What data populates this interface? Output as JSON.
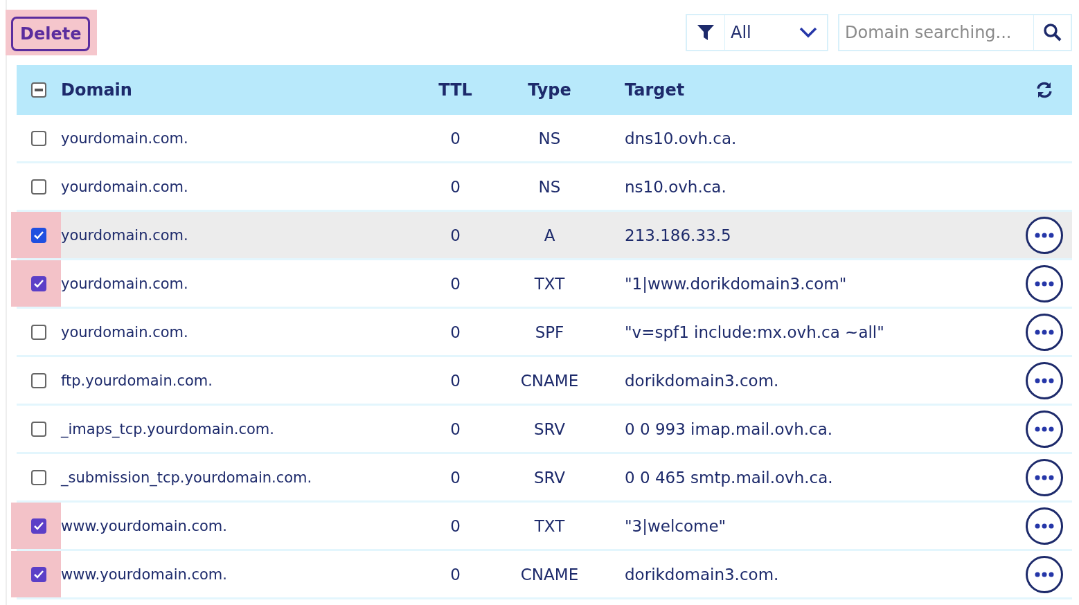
{
  "toolbar": {
    "delete_button": {
      "label": "Delete",
      "highlighted": true
    },
    "filter": {
      "value": "All"
    },
    "search": {
      "placeholder": "Domain searching..."
    }
  },
  "table": {
    "select_all_partial": true,
    "columns": [
      "Domain",
      "TTL",
      "Type",
      "Target"
    ],
    "rows": [
      {
        "domain": "yourdomain.com.",
        "ttl": "0",
        "type": "NS",
        "target": "dns10.ovh.ca.",
        "checked": false,
        "hovered": false,
        "highlighted": false,
        "has_actions": false
      },
      {
        "domain": "yourdomain.com.",
        "ttl": "0",
        "type": "NS",
        "target": "ns10.ovh.ca.",
        "checked": false,
        "hovered": false,
        "highlighted": false,
        "has_actions": false
      },
      {
        "domain": "yourdomain.com.",
        "ttl": "0",
        "type": "A",
        "target": "213.186.33.5",
        "checked": true,
        "hovered": true,
        "highlighted": true,
        "has_actions": true
      },
      {
        "domain": "yourdomain.com.",
        "ttl": "0",
        "type": "TXT",
        "target": "\"1|www.dorikdomain3.com\"",
        "checked": true,
        "hovered": false,
        "highlighted": true,
        "has_actions": true
      },
      {
        "domain": "yourdomain.com.",
        "ttl": "0",
        "type": "SPF",
        "target": "\"v=spf1 include:mx.ovh.ca ~all\"",
        "checked": false,
        "hovered": false,
        "highlighted": false,
        "has_actions": true
      },
      {
        "domain": "ftp.yourdomain.com.",
        "ttl": "0",
        "type": "CNAME",
        "target": "dorikdomain3.com.",
        "checked": false,
        "hovered": false,
        "highlighted": false,
        "has_actions": true
      },
      {
        "domain": "_imaps_tcp.yourdomain.com.",
        "ttl": "0",
        "type": "SRV",
        "target": "0 0 993 imap.mail.ovh.ca.",
        "checked": false,
        "hovered": false,
        "highlighted": false,
        "has_actions": true
      },
      {
        "domain": "_submission_tcp.yourdomain.com.",
        "ttl": "0",
        "type": "SRV",
        "target": "0 0 465 smtp.mail.ovh.ca.",
        "checked": false,
        "hovered": false,
        "highlighted": false,
        "has_actions": true
      },
      {
        "domain": "www.yourdomain.com.",
        "ttl": "0",
        "type": "TXT",
        "target": "\"3|welcome\"",
        "checked": true,
        "hovered": false,
        "highlighted": true,
        "has_actions": true
      },
      {
        "domain": "www.yourdomain.com.",
        "ttl": "0",
        "type": "CNAME",
        "target": "dorikdomain3.com.",
        "checked": true,
        "hovered": false,
        "highlighted": true,
        "has_actions": true
      }
    ]
  }
}
